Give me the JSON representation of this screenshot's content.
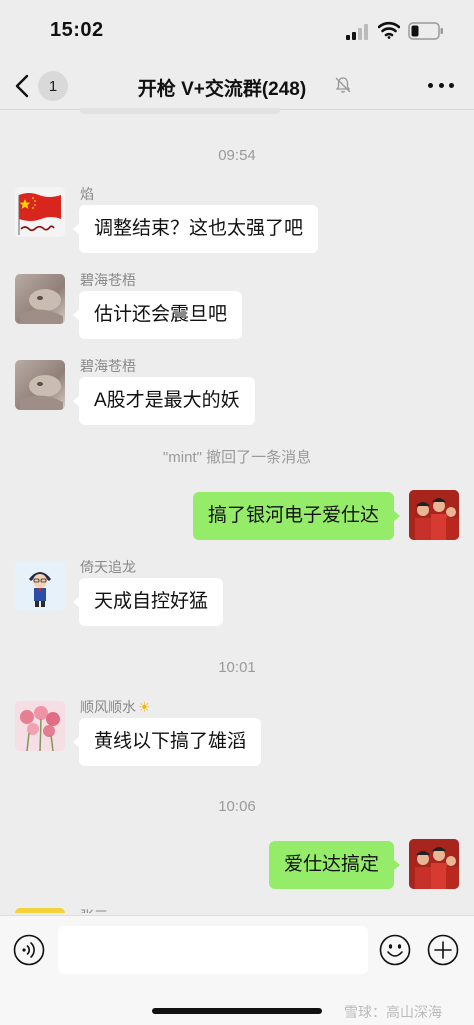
{
  "status_bar": {
    "time": "15:02"
  },
  "nav": {
    "unread_count": "1",
    "title": "开枪 V+交流群(248)"
  },
  "messages": [
    {
      "type": "time",
      "text": "09:54"
    },
    {
      "type": "in",
      "sender": "焰",
      "text": "调整结束？这也太强了吧",
      "avatar": "china-flag-avatar"
    },
    {
      "type": "in",
      "sender": "碧海苍梧",
      "text": "估计还会震旦吧",
      "avatar": "pet-photo-avatar"
    },
    {
      "type": "in",
      "sender": "碧海苍梧",
      "text": "A股才是最大的妖",
      "avatar": "pet-photo-avatar"
    },
    {
      "type": "recall",
      "text": "\"mint\" 撤回了一条消息"
    },
    {
      "type": "out",
      "text": "搞了银河电子爱仕达",
      "avatar": "group-photo-avatar"
    },
    {
      "type": "in",
      "sender": "倚天追龙",
      "text": "天成自控好猛",
      "avatar": "cartoon-detective-avatar"
    },
    {
      "type": "time",
      "text": "10:01"
    },
    {
      "type": "in",
      "sender": "顺风顺水",
      "sender_suffix": "☀",
      "text": "黄线以下搞了雄滔",
      "avatar": "pink-flowers-avatar"
    },
    {
      "type": "time",
      "text": "10:06"
    },
    {
      "type": "out",
      "text": "爱仕达搞定",
      "avatar": "group-photo-avatar"
    },
    {
      "type": "in-partial",
      "sender": "张三"
    }
  ],
  "input": {
    "placeholder": ""
  },
  "watermark": "雪球：高山深海",
  "colors": {
    "background": "#ededed",
    "bubble_out": "#95ec69",
    "bubble_in": "#ffffff"
  }
}
